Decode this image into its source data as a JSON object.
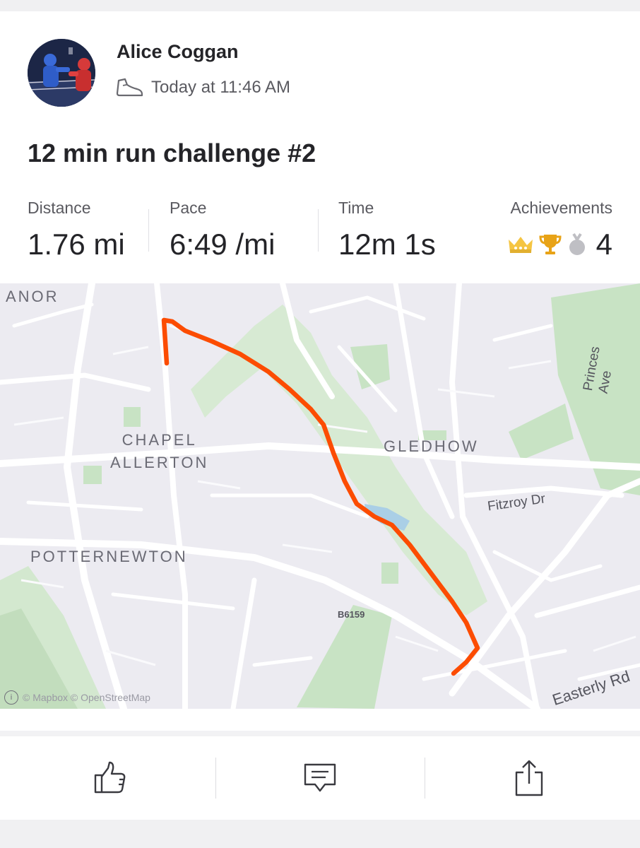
{
  "activity": {
    "athlete_name": "Alice Coggan",
    "timestamp": "Today at 11:46 AM",
    "sport_icon": "running-shoe-icon",
    "title": "12 min run challenge #2"
  },
  "stats": {
    "distance": {
      "label": "Distance",
      "value": "1.76 mi"
    },
    "pace": {
      "label": "Pace",
      "value": "6:49 /mi"
    },
    "time": {
      "label": "Time",
      "value": "12m 1s"
    },
    "achievements": {
      "label": "Achievements",
      "count": "4",
      "icons": [
        "crown-icon",
        "trophy-icon",
        "silver-medal-icon"
      ]
    }
  },
  "map": {
    "place_labels": {
      "anor": "ANOR",
      "chapel_allerton": "CHAPEL\nALLERTON",
      "gledhow": "GLEDHOW",
      "potternewton": "POTTERNEWTON"
    },
    "road_labels": {
      "princes_ave": "Princes Ave",
      "fitzroy_dr": "Fitzroy Dr",
      "easterly_rd": "Easterly Rd",
      "b6159": "B6159"
    },
    "attribution": "© Mapbox © OpenStreetMap",
    "route_color": "#fc4c02"
  },
  "actions": {
    "kudos_icon": "thumbs-up-icon",
    "comment_icon": "comment-icon",
    "share_icon": "share-icon"
  },
  "colors": {
    "accent": "#fc4c02",
    "crown": "#f5c542",
    "trophy": "#e8a317",
    "silver": "#bfbfc4"
  }
}
